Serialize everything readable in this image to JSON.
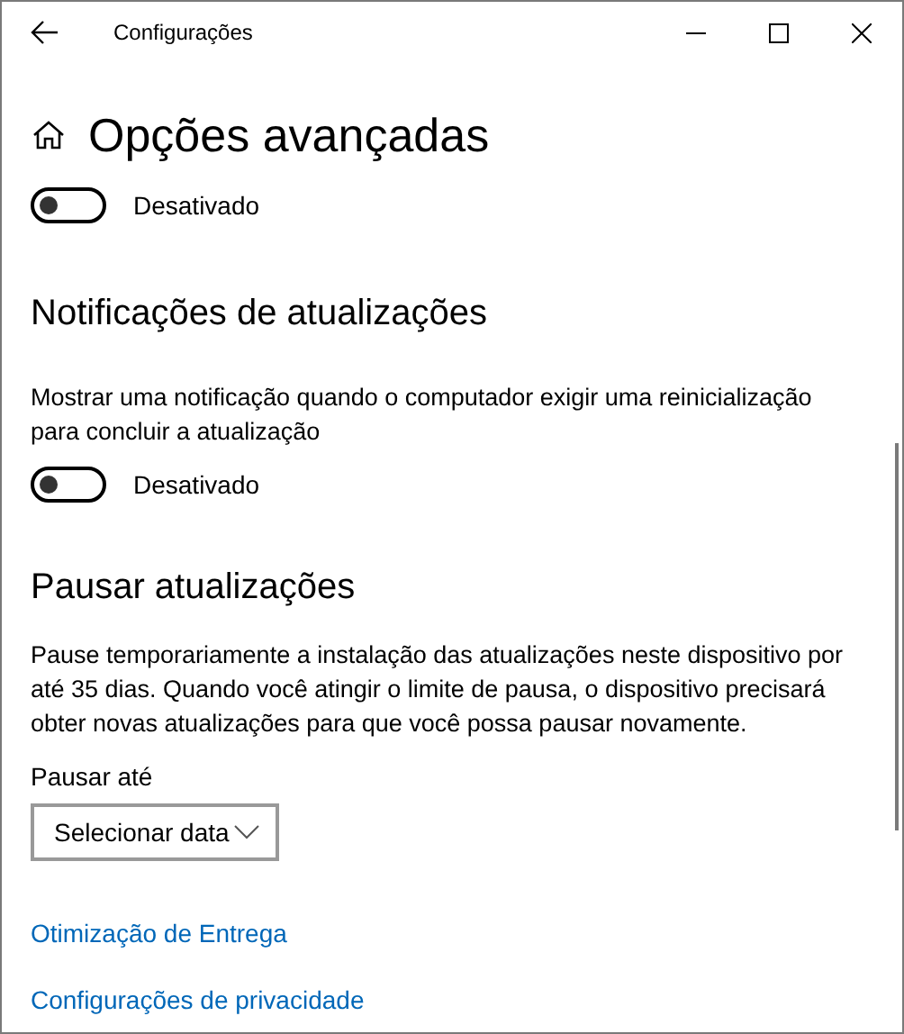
{
  "window": {
    "title": "Configurações"
  },
  "page": {
    "title": "Opções avançadas"
  },
  "top_toggle": {
    "on": false,
    "label": "Desativado"
  },
  "notifications": {
    "heading": "Notificações de atualizações",
    "description": "Mostrar uma notificação quando o computador exigir uma reinicialização para concluir a atualização",
    "toggle": {
      "on": false,
      "label": "Desativado"
    }
  },
  "pause": {
    "heading": "Pausar atualizações",
    "description": "Pause temporariamente a instalação das atualizações neste dispositivo por até 35 dias. Quando você atingir o limite de pausa, o dispositivo precisará obter novas atualizações para que você possa pausar novamente.",
    "field_label": "Pausar até",
    "dropdown": {
      "value": "Selecionar data"
    }
  },
  "links": [
    "Otimização de Entrega",
    "Configurações de privacidade"
  ]
}
